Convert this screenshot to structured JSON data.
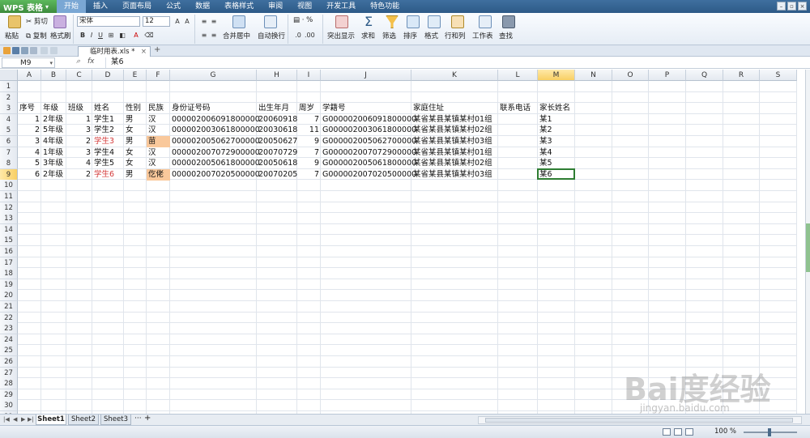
{
  "app": {
    "name": "WPS 表格"
  },
  "menu": [
    "开始",
    "插入",
    "页面布局",
    "公式",
    "数据",
    "表格样式",
    "审阅",
    "视图",
    "开发工具",
    "特色功能"
  ],
  "ribbon": {
    "paste": "粘贴",
    "cut": "剪切",
    "copy": "复制",
    "format_painter": "格式刷",
    "font_name": "宋体",
    "font_size": "12",
    "merge_center": "合并居中",
    "wrap_text": "自动换行",
    "highlight": "突出显示",
    "sum": "求和",
    "filter": "筛选",
    "sort": "排序",
    "format": "格式",
    "rows_cols": "行和列",
    "worksheet": "工作表",
    "find": "查找",
    "bold": "B",
    "italic": "I",
    "underline": "U",
    "percent": "%"
  },
  "doc_tab": {
    "name": "临时用表.xls *"
  },
  "formula_bar": {
    "cell_ref": "M9",
    "fx": "fx",
    "content": "某6"
  },
  "columns": [
    "A",
    "B",
    "C",
    "D",
    "E",
    "F",
    "G",
    "H",
    "I",
    "J",
    "K",
    "L",
    "M",
    "N",
    "O",
    "P",
    "Q",
    "R",
    "S"
  ],
  "rows": [
    "1",
    "2",
    "3",
    "4",
    "5",
    "6",
    "7",
    "8",
    "9",
    "10",
    "11",
    "12",
    "13",
    "14",
    "15",
    "16",
    "17",
    "18",
    "19",
    "20",
    "21",
    "22",
    "23",
    "24",
    "25",
    "26",
    "27",
    "28",
    "29",
    "30",
    "31"
  ],
  "table": {
    "headers": [
      "序号",
      "年级",
      "班级",
      "姓名",
      "性别",
      "民族",
      "身份证号码",
      "出生年月",
      "周岁",
      "学籍号",
      "家庭住址",
      "联系电话",
      "家长姓名"
    ],
    "records": [
      [
        "1",
        "2年级",
        "1",
        "学生1",
        "男",
        "汉",
        "000002006091800000",
        "20060918",
        "7",
        "G000002006091800000",
        "某省某县某镇某村01组",
        "",
        "某1"
      ],
      [
        "2",
        "5年级",
        "3",
        "学生2",
        "女",
        "汉",
        "000002003061800000",
        "20030618",
        "11",
        "G000002003061800000",
        "某省某县某镇某村02组",
        "",
        "某2"
      ],
      [
        "3",
        "4年级",
        "2",
        "学生3",
        "男",
        "苗",
        "000002005062700000",
        "20050627",
        "9",
        "G000002005062700000",
        "某省某县某镇某村03组",
        "",
        "某3"
      ],
      [
        "4",
        "1年级",
        "3",
        "学生4",
        "女",
        "汉",
        "000002007072900000",
        "20070729",
        "7",
        "G000002007072900000",
        "某省某县某镇某村01组",
        "",
        "某4"
      ],
      [
        "5",
        "3年级",
        "4",
        "学生5",
        "女",
        "汉",
        "000002005061800000",
        "20050618",
        "9",
        "G000002005061800000",
        "某省某县某镇某村02组",
        "",
        "某5"
      ],
      [
        "6",
        "2年级",
        "2",
        "学生6",
        "男",
        "仡佬",
        "000002007020500000",
        "20070205",
        "7",
        "G000002007020500000",
        "某省某县某镇某村03组",
        "",
        "某6"
      ]
    ]
  },
  "sheets": [
    "Sheet1",
    "Sheet2",
    "Sheet3"
  ],
  "status": {
    "zoom": "100 %"
  },
  "watermark": {
    "text": "Bai度经验",
    "sub": "jingyan.baidu.com"
  },
  "colors": {
    "accent": "#2e7d32",
    "highlight": "#f9c89b",
    "red_text": "#d43b3b"
  }
}
